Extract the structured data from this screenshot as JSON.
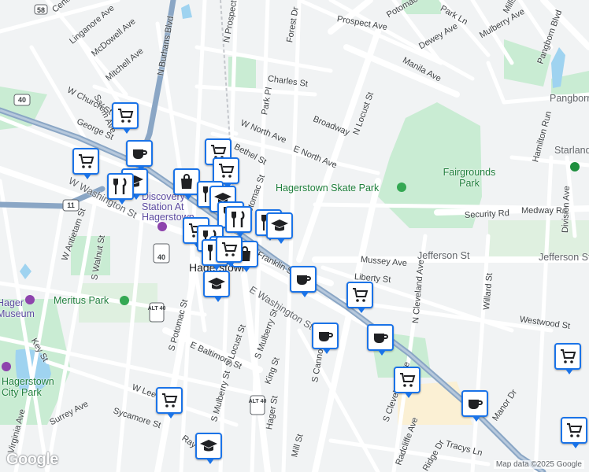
{
  "map": {
    "colors": {
      "land": "#f1f3f4",
      "park": "#c9ecd3",
      "water": "#9fd3f0",
      "road": "#ffffff",
      "highway": "#8aa6c5",
      "campus": "#fbf0d4",
      "pin_border": "#1a73e8"
    },
    "attribution": "Map data ©2025 Google",
    "google_logo": "Google",
    "streets": [
      "Prospect Ave",
      "Potomac St",
      "Dewey Ave",
      "Mulberry Ave",
      "Pangborn Blvd",
      "Forest Dr",
      "N Prospect St",
      "N Burhans Blvd",
      "Linganore Ave",
      "McDowell Ave",
      "Mitchell Ave",
      "Salem Ave",
      "Charles St",
      "Park Pl",
      "W North Ave",
      "Broadway",
      "N Locust St",
      "Manila Ave",
      "W Church St",
      "George St",
      "E North Ave",
      "Bethel St",
      "Potomac St",
      "W Washington St",
      "W Antietam St",
      "S Walnut St",
      "E Franklin St",
      "Mussey Ave",
      "Liberty St",
      "Jefferson St",
      "Jefferson St",
      "Security Rd",
      "Medway Rd",
      "Division Ave",
      "Hamilton Run",
      "N Cleveland Ave",
      "Willard St",
      "Westwood St",
      "E Washington St",
      "S Potomac St",
      "S Locust St",
      "S Mulberry St",
      "E Baltimore St",
      "King St",
      "Hager St",
      "S Cannon Ave",
      "S Mulberry St",
      "Key St",
      "W Lee St",
      "Sycamore St",
      "Surrey Ave",
      "Virginia Ave",
      "Mill St",
      "S Cleveland Ave",
      "Manor Dr",
      "Tracys Ln",
      "Radcliffe Ave",
      "Ray St",
      "Ridge Dr",
      "Central Ave",
      "Park Ln",
      "Mills St"
    ],
    "places": [
      "Hagerstown Skate Park",
      "Fairgrounds Park",
      "Meritus Park",
      "Discovery Station At Hagerstown",
      "Hagerstown City Park",
      "Hager Museum",
      "Pangborn",
      "Starland",
      "Hagerstown"
    ],
    "route_shields": [
      "58",
      "40",
      "11",
      "40",
      "ALT 40",
      "ALT 40",
      "ALT 40"
    ],
    "markers": [
      {
        "kind": "grocery"
      },
      {
        "kind": "cafe"
      },
      {
        "kind": "grocery"
      },
      {
        "kind": "school"
      },
      {
        "kind": "restaurant"
      },
      {
        "kind": "grocery"
      },
      {
        "kind": "grocery"
      },
      {
        "kind": "shopping"
      },
      {
        "kind": "restaurant"
      },
      {
        "kind": "school"
      },
      {
        "kind": "restaurant"
      },
      {
        "kind": "grocery"
      },
      {
        "kind": "restaurant"
      },
      {
        "kind": "restaurant"
      },
      {
        "kind": "restaurant"
      },
      {
        "kind": "restaurant"
      },
      {
        "kind": "shopping"
      },
      {
        "kind": "restaurant"
      },
      {
        "kind": "school"
      },
      {
        "kind": "cafe"
      },
      {
        "kind": "cafe"
      },
      {
        "kind": "grocery"
      },
      {
        "kind": "cafe"
      },
      {
        "kind": "cafe"
      },
      {
        "kind": "grocery"
      },
      {
        "kind": "grocery"
      },
      {
        "kind": "school"
      },
      {
        "kind": "grocery"
      },
      {
        "kind": "grocery"
      },
      {
        "kind": "school"
      },
      {
        "kind": "grocery"
      }
    ]
  }
}
